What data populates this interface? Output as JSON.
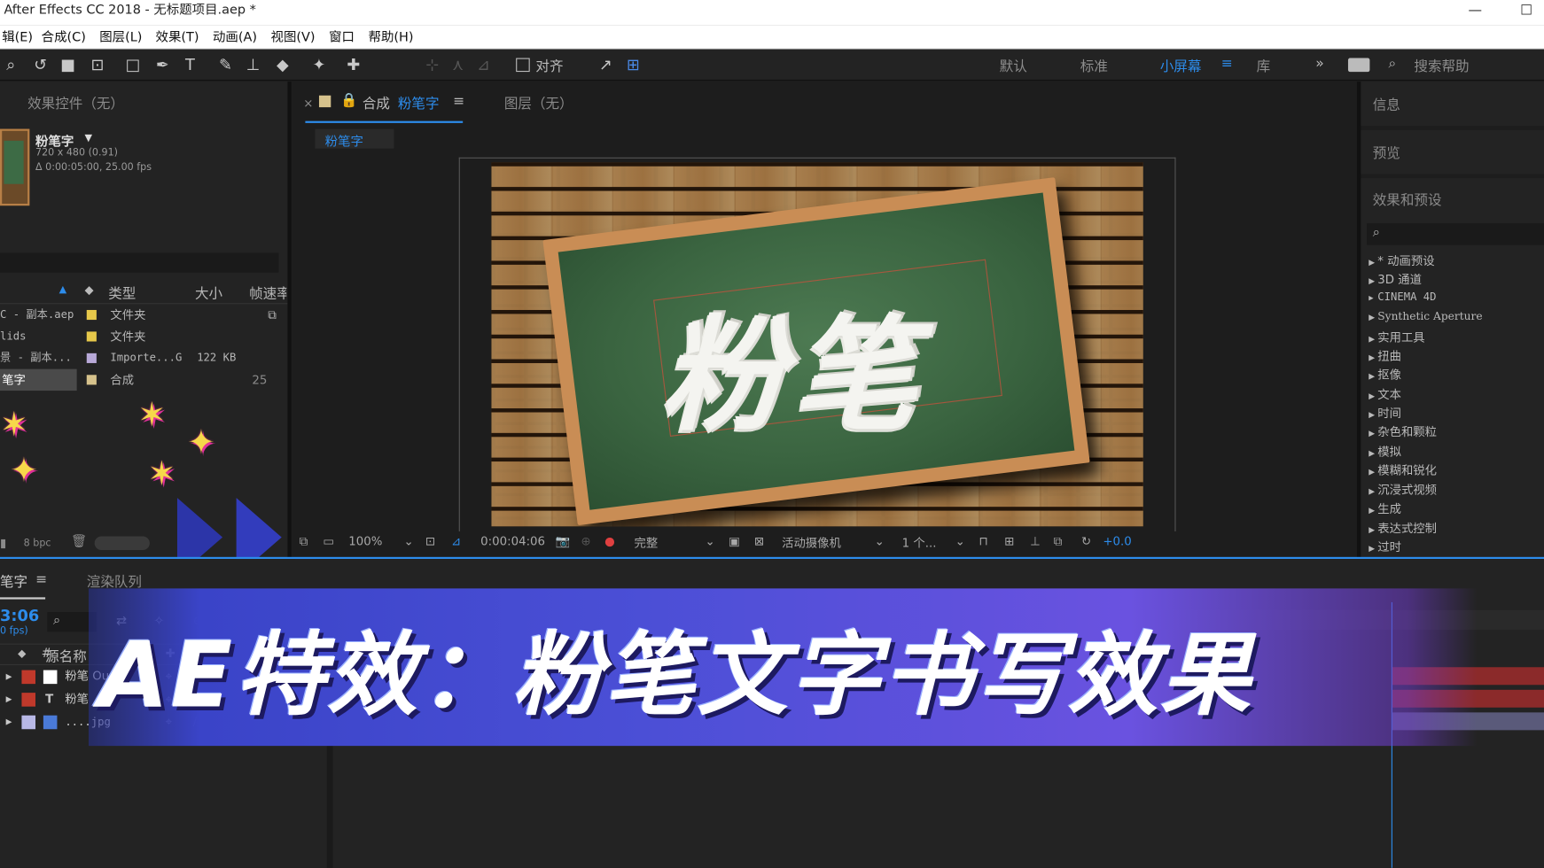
{
  "window": {
    "title": "After Effects CC 2018 - 无标题项目.aep *",
    "minimize": "—",
    "maximize": "☐"
  },
  "menu": [
    "辑(E)",
    "合成(C)",
    "图层(L)",
    "效果(T)",
    "动画(A)",
    "视图(V)",
    "窗口",
    "帮助(H)"
  ],
  "toolbar": {
    "snap_label": "对齐",
    "workspaces": [
      "默认",
      "标准",
      "小屏幕",
      "库"
    ],
    "active_workspace": "小屏幕",
    "overflow": "»",
    "search_placeholder": "搜索帮助"
  },
  "effect_controls": {
    "title": "效果控件（无）"
  },
  "project": {
    "comp_name": "粉笔字",
    "dropdown": "▼",
    "comp_dims": "720 x 480 (0.91)",
    "comp_duration": "Δ 0:00:05:00, 25.00 fps",
    "columns": {
      "type": "类型",
      "size": "大小",
      "fps": "帧速率"
    },
    "rows": [
      {
        "name": "C - 副本.aep",
        "type": "文件夹",
        "size": "",
        "extra": "",
        "color": "#e6c84a"
      },
      {
        "name": "lids",
        "type": "文件夹",
        "size": "",
        "extra": "",
        "color": "#e6c84a"
      },
      {
        "name": "景 - 副本...",
        "type": "Importe...G",
        "size": "122 KB",
        "extra": "",
        "color": "#b8a9d8"
      },
      {
        "name": "笔字",
        "type": "合成",
        "size": "",
        "extra": "25",
        "color": "#d6c28c"
      }
    ],
    "bpc": "8 bpc"
  },
  "comp_viewer": {
    "close": "×",
    "tab_prefix": "合成",
    "tab_name": "粉笔字",
    "layer_tab": "图层（无）",
    "breadcrumb": "粉笔字",
    "zoom": "100%",
    "timecode": "0:00:04:06",
    "quality": "完整",
    "camera": "活动摄像机",
    "views": "1 个...",
    "exposure": "+0.0",
    "chalk_text": "粉笔"
  },
  "right_panels": {
    "info": "信息",
    "preview": "预览",
    "effects_presets": "效果和预设",
    "search_icon": "⌕",
    "categories": [
      "* 动画预设",
      "3D 通道",
      "CINEMA 4D",
      "Synthetic Aperture",
      "实用工具",
      "扭曲",
      "抠像",
      "文本",
      "时间",
      "杂色和颗粒",
      "模拟",
      "模糊和锐化",
      "沉浸式视频",
      "生成",
      "表达式控制",
      "过时"
    ]
  },
  "timeline": {
    "comp_tab": "笔字",
    "render_queue": "渲染队列",
    "current_time": "3:06",
    "fps_note": "0 fps)",
    "source_name_header": "源名称",
    "layers": [
      {
        "name": "粉笔 Ou...",
        "color": "#c0392b",
        "box": "#ffffff",
        "kind": ""
      },
      {
        "name": "粉笔",
        "color": "#c0392b",
        "box": "",
        "kind": "T"
      },
      {
        "name": "....jpg",
        "color": "#b8b8e6",
        "box": "#4a7ad8",
        "kind": ""
      }
    ]
  },
  "overlay": {
    "title": "AE特效：粉笔文字书写效果"
  },
  "colors": {
    "accent": "#2d8ceb",
    "banner_start": "#3a44c8",
    "banner_end": "#6a52e0",
    "sparkle": "#f6d84a"
  }
}
